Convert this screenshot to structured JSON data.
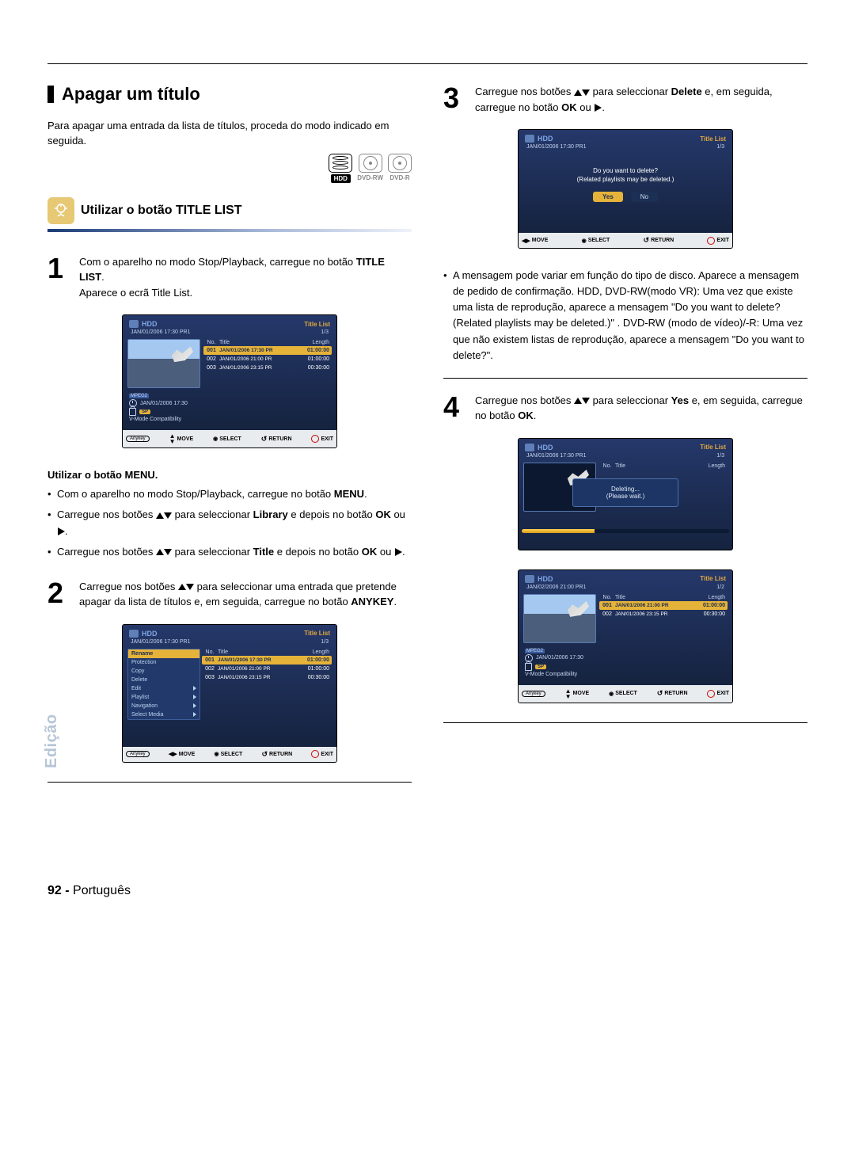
{
  "sideLabel": "Edição",
  "footer": {
    "pageNum": "92 -",
    "lang": "Português"
  },
  "section": {
    "title": "Apagar um título"
  },
  "intro": "Para apagar uma entrada da lista de títulos, proceda do modo indicado em seguida.",
  "badges": {
    "hdd": "HDD",
    "dvdrw": "DVD-RW",
    "dvdr": "DVD-R"
  },
  "subHead": "Utilizar o botão TITLE LIST",
  "steps": {
    "s1": {
      "num": "1",
      "l1a": "Com o aparelho no modo Stop/Playback, carregue no botão ",
      "l1b": "TITLE LIST",
      "l1c": ".",
      "l2": "Aparece o ecrã Title List."
    },
    "s2": {
      "num": "2",
      "l1a": "Carregue nos botões ",
      "l1b": " para seleccionar uma entrada que pretende apagar da lista de títulos e, em seguida, carregue no botão ",
      "l1c": "ANYKEY",
      "l1d": "."
    },
    "s3": {
      "num": "3",
      "l1a": "Carregue nos botões ",
      "l1b": " para seleccionar ",
      "l1c": "Delete",
      "l1d": " e, em seguida, carregue no botão ",
      "l1e": "OK",
      "l1f": " ou "
    },
    "s4": {
      "num": "4",
      "l1a": "Carregue nos botões ",
      "l1b": " para seleccionar ",
      "l1c": "Yes",
      "l1d": " e, em seguida, carregue no botão ",
      "l1e": "OK",
      "l1f": "."
    }
  },
  "menuBlock": {
    "title": "Utilizar o botão MENU.",
    "b1a": "Com o aparelho no modo Stop/Playback, carregue no botão ",
    "b1b": "MENU",
    "b1c": ".",
    "b2a": "Carregue nos botões ",
    "b2b": " para seleccionar ",
    "b2c": "Library",
    "b2d": " e depois no botão ",
    "b2e": "OK",
    "b2f": " ou ",
    "b3a": "Carregue nos botões ",
    "b3b": " para seleccionar ",
    "b3c": "Title",
    "b3d": " e depois no botão ",
    "b3e": "OK",
    "b3f": " ou "
  },
  "note": "A mensagem pode variar em função do tipo de disco. Aparece a mensagem de pedido de confirmação. HDD, DVD-RW(modo VR): Uma vez que existe uma lista de reprodução, aparece a mensagem \"Do you want to delete? (Related playlists may be deleted.)\" . DVD-RW (modo de vídeo)/-R: Uma vez que não existem listas de reprodução, aparece a mensagem \"Do you want to delete?\".",
  "osd": {
    "hdd": "HDD",
    "titleList": "Title List",
    "headerDate": "JAN/01/2006 17:30 PR1",
    "pager13": "1/3",
    "pager12": "1/2",
    "colNo": "No.",
    "colTitle": "Title",
    "colLength": "Length",
    "rows3": [
      {
        "no": "001",
        "title": "JAN/01/2006 17:30 PR",
        "len": "01:00:00"
      },
      {
        "no": "002",
        "title": "JAN/01/2006 21:00 PR",
        "len": "01:00:00"
      },
      {
        "no": "003",
        "title": "JAN/01/2006 23:15 PR",
        "len": "00:30:00"
      }
    ],
    "rows2header": "JAN/02/2006 21:00 PR1",
    "rows2": [
      {
        "no": "001",
        "title": "JAN/01/2006 21:00 PR",
        "len": "01:00:00"
      },
      {
        "no": "002",
        "title": "JAN/01/2006 23:15 PR",
        "len": "00:30:00"
      }
    ],
    "infoDate": "JAN/01/2006 17:30",
    "infoSP": "SP",
    "infoCompat": "V-Mode Compatibility",
    "mpeg2": "MPEG2",
    "footer": {
      "anykey": "Anykey",
      "move": "MOVE",
      "select": "SELECT",
      "return": "RETURN",
      "exit": "EXIT"
    },
    "footerMoveLR": "MOVE",
    "sideMenu": [
      "Rename",
      "Protection",
      "Copy",
      "Delete",
      "Edit",
      "Playlist",
      "Navigation",
      "Select Media"
    ],
    "confirmMsg1": "Do you want to delete?",
    "confirmMsg2": "(Related playlists may be deleted.)",
    "yes": "Yes",
    "no": "No",
    "deleting1": "Deleting...",
    "deleting2": "(Please wait.)"
  }
}
